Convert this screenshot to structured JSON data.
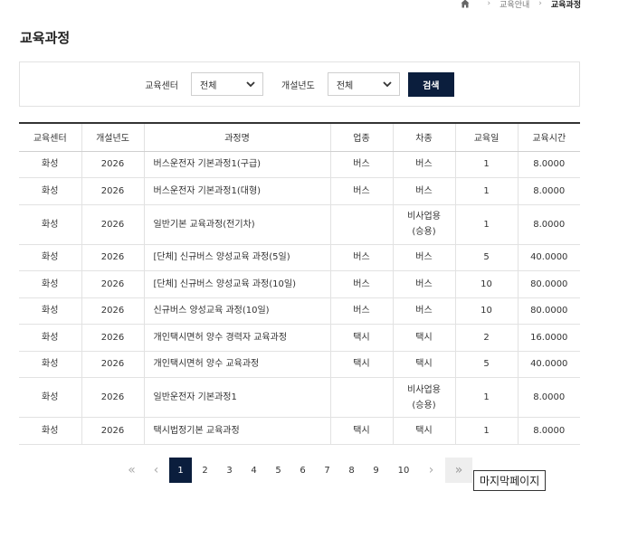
{
  "breadcrumb": {
    "home_icon": "home-icon",
    "items": [
      "교육안내",
      "교육과정"
    ]
  },
  "page_title": "교육과정",
  "search": {
    "center_label": "교육센터",
    "center_value": "전체",
    "year_label": "개설년도",
    "year_value": "전체",
    "button": "검색"
  },
  "table": {
    "headers": [
      "교육센터",
      "개설년도",
      "과정명",
      "업종",
      "차종",
      "교육일",
      "교육시간"
    ],
    "rows": [
      {
        "center": "화성",
        "year": "2026",
        "name": "버스운전자 기본과정1(구급)",
        "industry": "버스",
        "vehicle_line1": "버스",
        "vehicle_line2": "",
        "days": "1",
        "hours": "8.0000"
      },
      {
        "center": "화성",
        "year": "2026",
        "name": "버스운전자 기본과정1(대형)",
        "industry": "버스",
        "vehicle_line1": "버스",
        "vehicle_line2": "",
        "days": "1",
        "hours": "8.0000"
      },
      {
        "center": "화성",
        "year": "2026",
        "name": "일반기본 교육과정(전기차)",
        "industry": "",
        "vehicle_line1": "비사업용",
        "vehicle_line2": "(승용)",
        "days": "1",
        "hours": "8.0000"
      },
      {
        "center": "화성",
        "year": "2026",
        "name": "[단체] 신규버스 양성교육 과정(5일)",
        "industry": "버스",
        "vehicle_line1": "버스",
        "vehicle_line2": "",
        "days": "5",
        "hours": "40.0000"
      },
      {
        "center": "화성",
        "year": "2026",
        "name": "[단체] 신규버스 양성교육 과정(10일)",
        "industry": "버스",
        "vehicle_line1": "버스",
        "vehicle_line2": "",
        "days": "10",
        "hours": "80.0000"
      },
      {
        "center": "화성",
        "year": "2026",
        "name": "신규버스 양성교육 과정(10일)",
        "industry": "버스",
        "vehicle_line1": "버스",
        "vehicle_line2": "",
        "days": "10",
        "hours": "80.0000"
      },
      {
        "center": "화성",
        "year": "2026",
        "name": "개인택시면허 양수 경력자 교육과정",
        "industry": "택시",
        "vehicle_line1": "택시",
        "vehicle_line2": "",
        "days": "2",
        "hours": "16.0000"
      },
      {
        "center": "화성",
        "year": "2026",
        "name": "개인택시면허 양수 교육과정",
        "industry": "택시",
        "vehicle_line1": "택시",
        "vehicle_line2": "",
        "days": "5",
        "hours": "40.0000"
      },
      {
        "center": "화성",
        "year": "2026",
        "name": "일반운전자 기본과정1",
        "industry": "",
        "vehicle_line1": "비사업용",
        "vehicle_line2": "(승용)",
        "days": "1",
        "hours": "8.0000"
      },
      {
        "center": "화성",
        "year": "2026",
        "name": "택시법정기본 교육과정",
        "industry": "택시",
        "vehicle_line1": "택시",
        "vehicle_line2": "",
        "days": "1",
        "hours": "8.0000"
      }
    ]
  },
  "pagination": {
    "first": "«",
    "prev": "‹",
    "pages": [
      "1",
      "2",
      "3",
      "4",
      "5",
      "6",
      "7",
      "8",
      "9",
      "10"
    ],
    "current": "1",
    "next": "›",
    "last": "»",
    "last_tooltip": "마지막페이지"
  }
}
